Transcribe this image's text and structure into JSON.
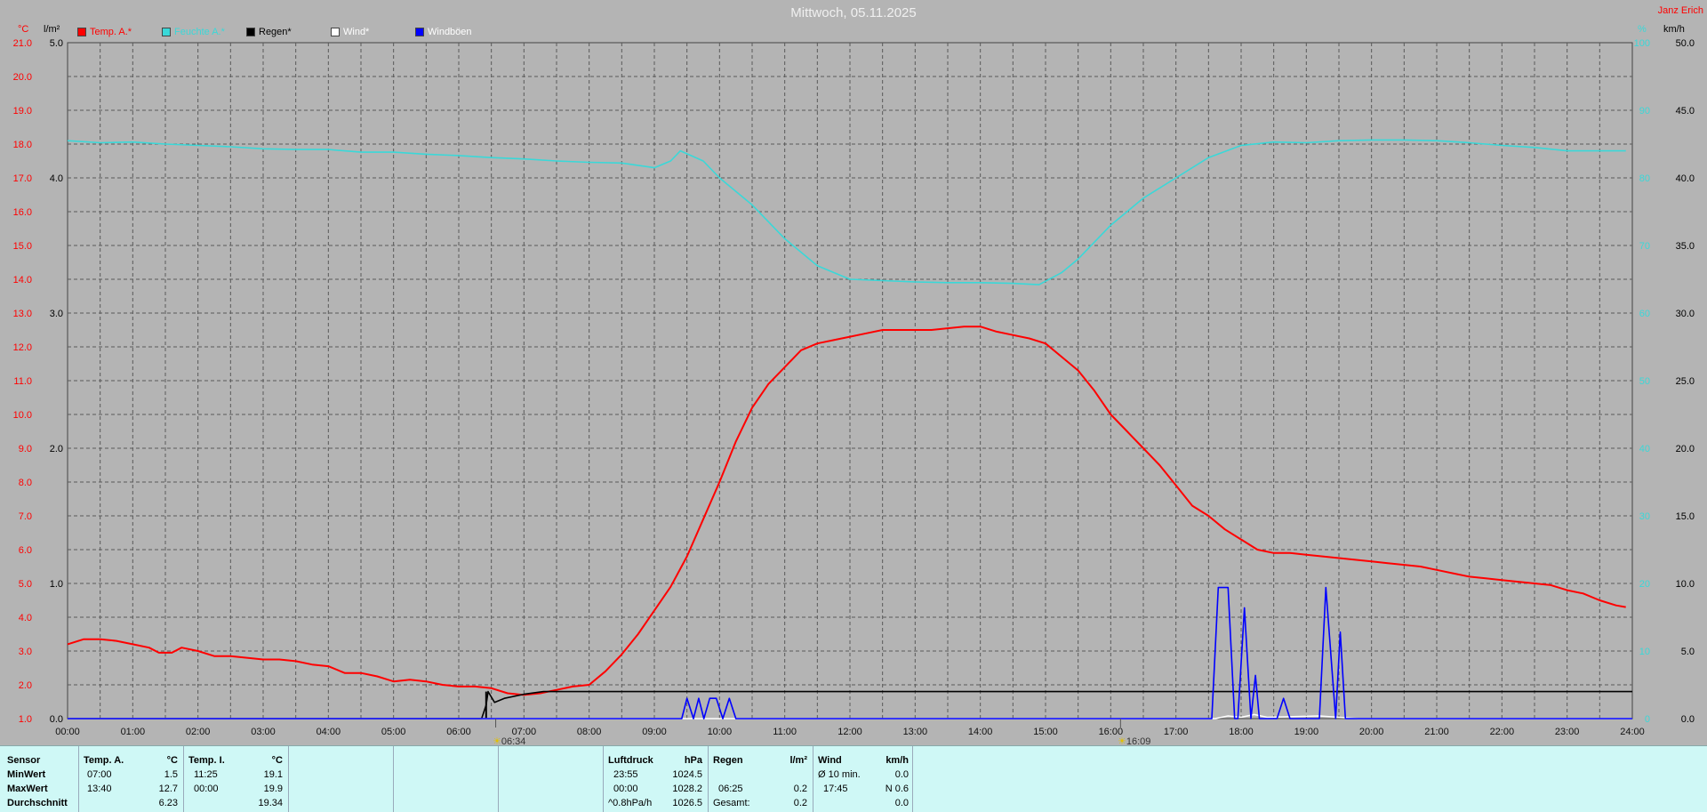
{
  "title": "Mittwoch, 05.11.2025",
  "author": "Janz Erich",
  "units": {
    "temp": "°C",
    "rain": "l/m²",
    "pct": "%",
    "wind": "km/h"
  },
  "legend": [
    {
      "label": "Temp. A.*",
      "color": "#ff0000",
      "text_color": "#ff0000"
    },
    {
      "label": "Feuchte A.*",
      "color": "#3ad8d8",
      "text_color": "#3ad8d8"
    },
    {
      "label": "Regen*",
      "color": "#000000",
      "text_color": "#000000"
    },
    {
      "label": "Wind*",
      "color": "#ffffff",
      "text_color": "#ffffff"
    },
    {
      "label": "Windböen",
      "color": "#0000ff",
      "text_color": "#ffffff"
    }
  ],
  "markers": [
    "06:34",
    "16:09"
  ],
  "chart_data": {
    "type": "line",
    "x_unit": "hours",
    "xlim": [
      0,
      24
    ],
    "x_ticks": [
      "00:00",
      "01:00",
      "02:00",
      "03:00",
      "04:00",
      "05:00",
      "06:00",
      "07:00",
      "08:00",
      "09:00",
      "10:00",
      "11:00",
      "12:00",
      "13:00",
      "14:00",
      "15:00",
      "16:00",
      "17:00",
      "18:00",
      "19:00",
      "20:00",
      "21:00",
      "22:00",
      "23:00",
      "24:00"
    ],
    "axes": {
      "temp": {
        "min": 1.0,
        "max": 21.0,
        "ticks": [
          "1.0",
          "2.0",
          "3.0",
          "4.0",
          "5.0",
          "6.0",
          "7.0",
          "8.0",
          "9.0",
          "10.0",
          "11.0",
          "12.0",
          "13.0",
          "14.0",
          "15.0",
          "16.0",
          "17.0",
          "18.0",
          "19.0",
          "20.0",
          "21.0"
        ],
        "color": "#ff0000"
      },
      "rain": {
        "min": 0.0,
        "max": 5.0,
        "ticks": [
          "0.0",
          "1.0",
          "2.0",
          "3.0",
          "4.0",
          "5.0"
        ]
      },
      "pct": {
        "min": 0,
        "max": 100,
        "ticks": [
          "0",
          "10",
          "20",
          "30",
          "40",
          "50",
          "60",
          "70",
          "80",
          "90",
          "100"
        ],
        "color": "#3ad8d8"
      },
      "wind": {
        "min": 0.0,
        "max": 50.0,
        "ticks": [
          "0.0",
          "5.0",
          "10.0",
          "15.0",
          "20.0",
          "25.0",
          "30.0",
          "35.0",
          "40.0",
          "45.0",
          "50.0"
        ]
      }
    },
    "series": [
      {
        "name": "Temp. A.*",
        "axis": "temp",
        "color": "#ff0000",
        "x": [
          0,
          0.25,
          0.5,
          0.75,
          1,
          1.25,
          1.4,
          1.6,
          1.75,
          2,
          2.25,
          2.5,
          2.75,
          3,
          3.25,
          3.5,
          3.75,
          4,
          4.25,
          4.5,
          4.75,
          5,
          5.25,
          5.5,
          5.75,
          6,
          6.25,
          6.5,
          6.75,
          7,
          7.25,
          7.5,
          7.75,
          8,
          8.25,
          8.5,
          8.75,
          9,
          9.25,
          9.5,
          9.75,
          10,
          10.25,
          10.5,
          10.75,
          11,
          11.25,
          11.5,
          11.75,
          12,
          12.25,
          12.5,
          12.75,
          13,
          13.25,
          13.5,
          13.75,
          14,
          14.25,
          14.5,
          14.75,
          15,
          15.25,
          15.5,
          15.75,
          16,
          16.25,
          16.5,
          16.75,
          17,
          17.25,
          17.5,
          17.75,
          18,
          18.25,
          18.5,
          18.75,
          19,
          19.25,
          19.5,
          19.75,
          20,
          20.25,
          20.5,
          20.75,
          21,
          21.25,
          21.5,
          21.75,
          22,
          22.25,
          22.5,
          22.75,
          23,
          23.25,
          23.5,
          23.75,
          23.9
        ],
        "y": [
          3.2,
          3.35,
          3.35,
          3.3,
          3.2,
          3.1,
          2.95,
          2.95,
          3.1,
          3.0,
          2.85,
          2.85,
          2.8,
          2.75,
          2.75,
          2.7,
          2.6,
          2.55,
          2.35,
          2.35,
          2.25,
          2.1,
          2.15,
          2.1,
          2.0,
          1.95,
          1.95,
          1.9,
          1.75,
          1.7,
          1.75,
          1.85,
          1.95,
          2.0,
          2.4,
          2.9,
          3.5,
          4.2,
          4.9,
          5.8,
          6.9,
          8.0,
          9.2,
          10.2,
          10.9,
          11.4,
          11.9,
          12.1,
          12.2,
          12.3,
          12.4,
          12.5,
          12.5,
          12.5,
          12.5,
          12.55,
          12.6,
          12.6,
          12.45,
          12.35,
          12.25,
          12.1,
          11.7,
          11.3,
          10.7,
          10.0,
          9.5,
          9.0,
          8.5,
          7.9,
          7.3,
          7.0,
          6.6,
          6.3,
          6.0,
          5.9,
          5.9,
          5.85,
          5.8,
          5.75,
          5.7,
          5.65,
          5.6,
          5.55,
          5.5,
          5.4,
          5.3,
          5.2,
          5.15,
          5.1,
          5.05,
          5.0,
          4.95,
          4.8,
          4.7,
          4.5,
          4.35,
          4.3
        ]
      },
      {
        "name": "Feuchte A.*",
        "axis": "pct",
        "color": "#3ad8d8",
        "x": [
          0,
          0.5,
          1,
          1.5,
          2,
          2.5,
          3,
          3.5,
          4,
          4.5,
          5,
          5.5,
          6,
          6.5,
          7,
          7.5,
          8,
          8.5,
          9,
          9.25,
          9.4,
          9.75,
          10,
          10.5,
          11,
          11.5,
          12,
          12.5,
          13,
          13.5,
          14,
          14.5,
          14.9,
          15.25,
          15.5,
          16,
          16.5,
          17,
          17.5,
          18,
          18.5,
          19,
          19.5,
          20,
          20.5,
          21,
          21.5,
          22,
          22.5,
          23,
          23.5,
          23.9
        ],
        "y": [
          85.5,
          85.2,
          85.3,
          85.0,
          84.8,
          84.6,
          84.3,
          84.2,
          84.2,
          83.8,
          83.8,
          83.5,
          83.3,
          83.0,
          82.8,
          82.5,
          82.3,
          82.2,
          81.5,
          82.5,
          84.0,
          82.5,
          80.0,
          76.0,
          71.0,
          67.0,
          65.0,
          64.8,
          64.6,
          64.5,
          64.5,
          64.4,
          64.2,
          66.0,
          68.0,
          73.0,
          77.0,
          80.0,
          83.0,
          84.8,
          85.3,
          85.2,
          85.5,
          85.6,
          85.6,
          85.5,
          85.2,
          84.8,
          84.5,
          84.0,
          84.0,
          84.0
        ]
      },
      {
        "name": "Regen*",
        "axis": "rain",
        "color": "#000000",
        "x": [
          0,
          6.35,
          6.42,
          6.45,
          6.55,
          6.7,
          7.0,
          7.3,
          7.6,
          24
        ],
        "y": [
          0,
          0,
          0.1,
          0.2,
          0.12,
          0.15,
          0.18,
          0.2,
          0.2,
          0.2
        ],
        "spike": {
          "x": 6.42,
          "y": 0.2
        }
      },
      {
        "name": "Wind*",
        "axis": "wind",
        "color": "#ffffff",
        "x": [
          0,
          17.6,
          17.8,
          18.0,
          18.2,
          18.4,
          19.2,
          19.5,
          19.8,
          24
        ],
        "y": [
          0,
          0,
          0.2,
          0.1,
          0.3,
          0.1,
          0.2,
          0.1,
          0,
          0
        ]
      },
      {
        "name": "Windböen",
        "axis": "wind",
        "color": "#0000ff",
        "x": [
          0,
          9.42,
          9.5,
          9.6,
          9.68,
          9.76,
          9.85,
          9.95,
          10.05,
          10.15,
          10.25,
          17.55,
          17.65,
          17.8,
          17.9,
          17.95,
          18.05,
          18.15,
          18.22,
          18.28,
          18.35,
          18.43,
          18.55,
          18.65,
          18.75,
          18.85,
          19.2,
          19.3,
          19.45,
          19.52,
          19.6,
          19.7,
          24
        ],
        "y": [
          0,
          0,
          1.5,
          0,
          1.5,
          0,
          1.5,
          1.5,
          0,
          1.5,
          0,
          0,
          9.7,
          9.7,
          0,
          0,
          8.2,
          0,
          3.2,
          0,
          0,
          0,
          0,
          1.5,
          0,
          0,
          0,
          9.7,
          0,
          6.4,
          0,
          0,
          0
        ]
      }
    ]
  },
  "stats": {
    "sensor": {
      "header": "Sensor",
      "rows": [
        "MinWert",
        "MaxWert",
        "Durchschnitt"
      ]
    },
    "temp_a": {
      "header": "Temp. A.",
      "unit": "°C",
      "times": [
        "07:00",
        "13:40",
        ""
      ],
      "values": [
        "1.5",
        "12.7",
        "6.23"
      ]
    },
    "temp_i": {
      "header": "Temp. I.",
      "unit": "°C",
      "times": [
        "11:25",
        "00:00",
        ""
      ],
      "values": [
        "19.1",
        "19.9",
        "19.34"
      ]
    },
    "pressure": {
      "header": "Luftdruck",
      "unit": "hPa",
      "times": [
        "23:55",
        "00:00",
        "^0.8hPa/h"
      ],
      "values": [
        "1024.5",
        "1028.2",
        "1026.5"
      ]
    },
    "rain": {
      "header": "Regen",
      "unit": "l/m²",
      "times": [
        "",
        "06:25",
        "Gesamt:"
      ],
      "values": [
        "",
        "0.2",
        "0.2"
      ]
    },
    "wind": {
      "header": "Wind",
      "unit": "km/h",
      "times": [
        "Ø 10 min.",
        "17:45",
        ""
      ],
      "values": [
        "0.0",
        "N 0.6",
        "0.0"
      ]
    }
  }
}
